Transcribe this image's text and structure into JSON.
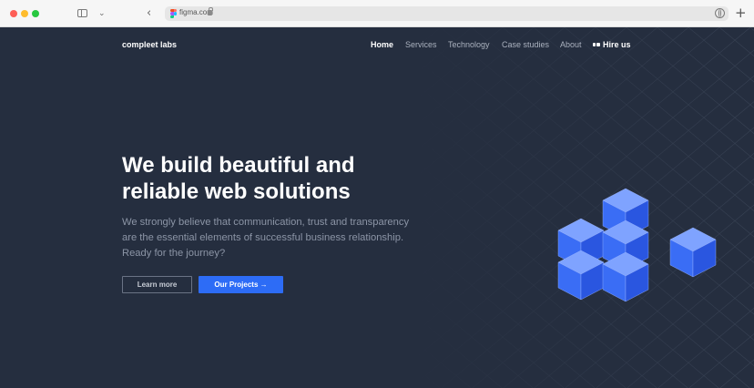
{
  "browser": {
    "url": "figma.com"
  },
  "site": {
    "logo": "compleet labs",
    "nav": [
      {
        "label": "Home",
        "active": true
      },
      {
        "label": "Services",
        "active": false
      },
      {
        "label": "Technology",
        "active": false
      },
      {
        "label": "Case studies",
        "active": false
      },
      {
        "label": "About",
        "active": false
      }
    ],
    "hire_label": "Hire us"
  },
  "hero": {
    "headline_line1": "We build beautiful and",
    "headline_line2": "reliable web solutions",
    "subtext_line1": "We strongly believe that communication, trust and transparency",
    "subtext_line2": "are the essential elements of successful business relationship.",
    "subtext_line3": "Ready for the journey?",
    "learn_more_label": "Learn more",
    "projects_label": "Our Projects →"
  },
  "colors": {
    "background": "#252e3f",
    "accent": "#2d6cf6",
    "muted_text": "#8c95a6"
  }
}
